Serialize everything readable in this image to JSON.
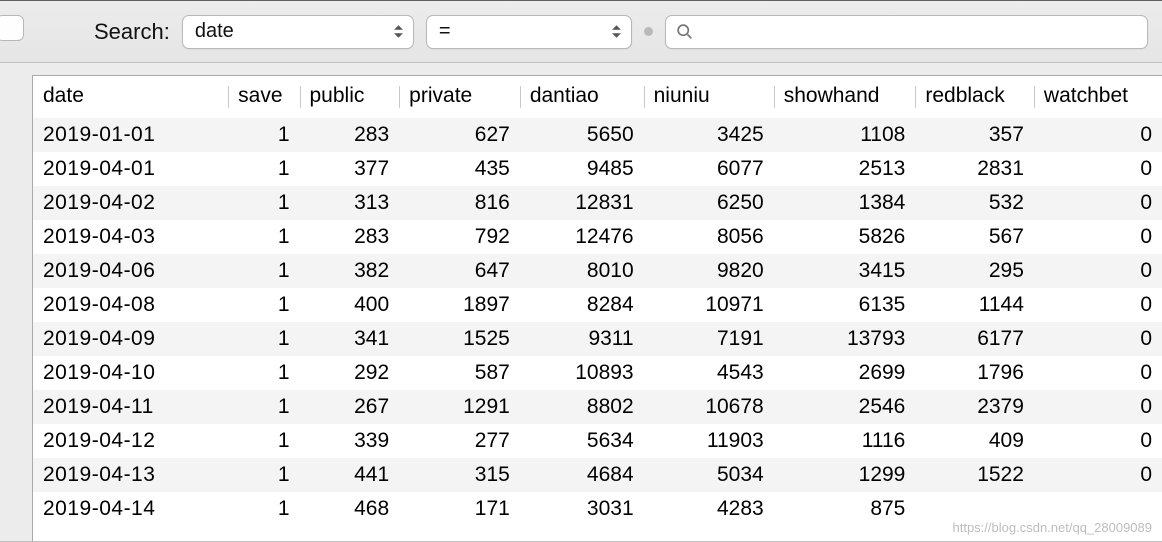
{
  "toolbar": {
    "search_label": "Search:",
    "field_select": "date",
    "operator_select": "=",
    "search_value": ""
  },
  "columns": [
    "date",
    "save",
    "public",
    "private",
    "dantiao",
    "niuniu",
    "showhand",
    "redblack",
    "watchbet"
  ],
  "rows": [
    {
      "date": "2019-01-01",
      "save": 1,
      "public": 283,
      "private": 627,
      "dantiao": 5650,
      "niuniu": 3425,
      "showhand": 1108,
      "redblack": 357,
      "watchbet": 0
    },
    {
      "date": "2019-04-01",
      "save": 1,
      "public": 377,
      "private": 435,
      "dantiao": 9485,
      "niuniu": 6077,
      "showhand": 2513,
      "redblack": 2831,
      "watchbet": 0
    },
    {
      "date": "2019-04-02",
      "save": 1,
      "public": 313,
      "private": 816,
      "dantiao": 12831,
      "niuniu": 6250,
      "showhand": 1384,
      "redblack": 532,
      "watchbet": 0
    },
    {
      "date": "2019-04-03",
      "save": 1,
      "public": 283,
      "private": 792,
      "dantiao": 12476,
      "niuniu": 8056,
      "showhand": 5826,
      "redblack": 567,
      "watchbet": 0
    },
    {
      "date": "2019-04-06",
      "save": 1,
      "public": 382,
      "private": 647,
      "dantiao": 8010,
      "niuniu": 9820,
      "showhand": 3415,
      "redblack": 295,
      "watchbet": 0
    },
    {
      "date": "2019-04-08",
      "save": 1,
      "public": 400,
      "private": 1897,
      "dantiao": 8284,
      "niuniu": 10971,
      "showhand": 6135,
      "redblack": 1144,
      "watchbet": 0
    },
    {
      "date": "2019-04-09",
      "save": 1,
      "public": 341,
      "private": 1525,
      "dantiao": 9311,
      "niuniu": 7191,
      "showhand": 13793,
      "redblack": 6177,
      "watchbet": 0
    },
    {
      "date": "2019-04-10",
      "save": 1,
      "public": 292,
      "private": 587,
      "dantiao": 10893,
      "niuniu": 4543,
      "showhand": 2699,
      "redblack": 1796,
      "watchbet": 0
    },
    {
      "date": "2019-04-11",
      "save": 1,
      "public": 267,
      "private": 1291,
      "dantiao": 8802,
      "niuniu": 10678,
      "showhand": 2546,
      "redblack": 2379,
      "watchbet": 0
    },
    {
      "date": "2019-04-12",
      "save": 1,
      "public": 339,
      "private": 277,
      "dantiao": 5634,
      "niuniu": 11903,
      "showhand": 1116,
      "redblack": 409,
      "watchbet": 0
    },
    {
      "date": "2019-04-13",
      "save": 1,
      "public": 441,
      "private": 315,
      "dantiao": 4684,
      "niuniu": 5034,
      "showhand": 1299,
      "redblack": 1522,
      "watchbet": 0
    },
    {
      "date": "2019-04-14",
      "save": 1,
      "public": 468,
      "private": 171,
      "dantiao": 3031,
      "niuniu": 4283,
      "showhand": 875,
      "redblack": "",
      "watchbet": ""
    }
  ],
  "watermark": "https://blog.csdn.net/qq_28009089"
}
